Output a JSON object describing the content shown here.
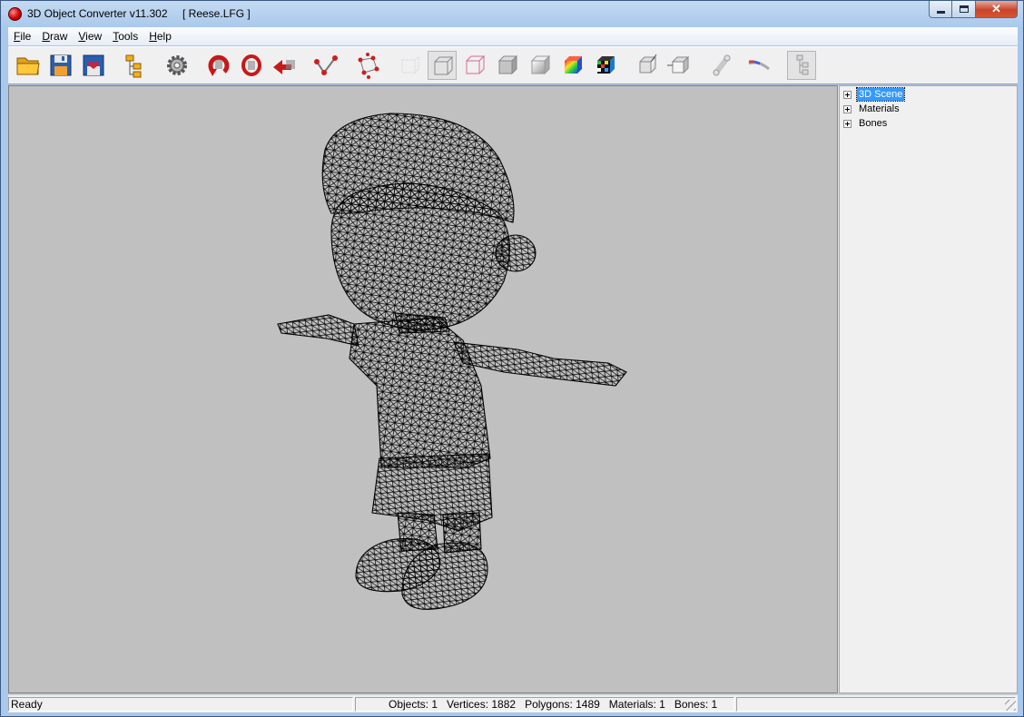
{
  "window": {
    "title": "3D Object Converter v11.302",
    "file": "[ Reese.LFG ]",
    "controls": {
      "minimize": "minimize",
      "maximize": "maximize",
      "close": "✕"
    }
  },
  "menu": [
    {
      "underline": "F",
      "rest": "ile"
    },
    {
      "underline": "D",
      "rest": "raw"
    },
    {
      "underline": "V",
      "rest": "iew"
    },
    {
      "underline": "T",
      "rest": "ools"
    },
    {
      "underline": "H",
      "rest": "elp"
    }
  ],
  "toolbar": {
    "icons": [
      "open-folder-icon",
      "save-icon",
      "save-favorite-icon",
      "hierarchy-icon",
      "settings-gear-icon",
      "rotate-icon",
      "orbit-icon",
      "move-icon",
      "vertex-edit-icon",
      "bounding-box-icon",
      "points-view-icon",
      "wireframe-view-icon",
      "wireframe-color-view-icon",
      "flat-shaded-view-icon",
      "smooth-shaded-view-icon",
      "color-shaded-view-icon",
      "textured-view-icon",
      "normals-icon",
      "backface-icon",
      "bones-icon",
      "texture-coordinates-icon",
      "scene-tree-icon"
    ],
    "pressed": [
      "wireframe-view-icon",
      "scene-tree-icon"
    ]
  },
  "tree": {
    "nodes": [
      {
        "label": "3D Scene",
        "selected": true
      },
      {
        "label": "Materials",
        "selected": false
      },
      {
        "label": "Bones",
        "selected": false
      }
    ]
  },
  "status": {
    "ready": "Ready",
    "stats": "Objects: 1   Vertices: 1882   Polygons: 1489   Materials: 1   Bones: 1",
    "extra": ""
  }
}
